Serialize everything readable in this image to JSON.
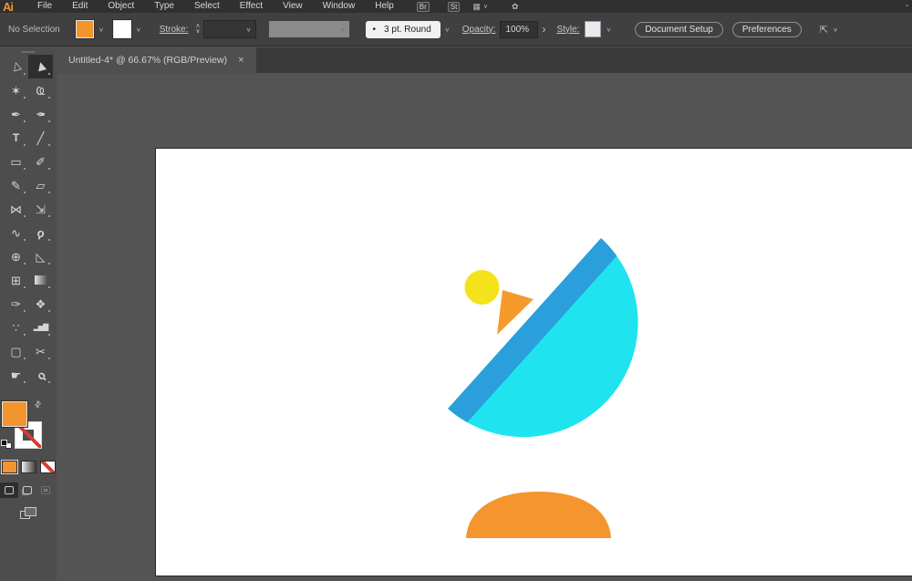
{
  "app": {
    "logo_text": "Ai"
  },
  "menu_bar": {
    "items": [
      "File",
      "Edit",
      "Object",
      "Type",
      "Select",
      "Effect",
      "View",
      "Window",
      "Help"
    ],
    "bridge_button": "Br",
    "stock_button": "St",
    "workspace_glyph": "▦",
    "workspace_chevron": "∨",
    "gpu_glyph": "✿",
    "corner_fragment": "⌄"
  },
  "control_bar": {
    "selection_status": "No Selection",
    "fill_chevron": "∨",
    "stroke_chevron": "∨",
    "stroke_label": "Stroke:",
    "stepper_up": "∧",
    "stepper_down": "∨",
    "stroke_width_chevron": "∨",
    "profile_chevron": "∨",
    "brush_bullet": "•",
    "brush_value": "3 pt. Round",
    "brush_chevron": "∨",
    "opacity_label": "Opacity:",
    "opacity_value": "100%",
    "opacity_more": "›",
    "style_label": "Style:",
    "style_chevron": "∨",
    "document_setup_button": "Document Setup",
    "preferences_button": "Preferences",
    "select_similar_glyph": "⇱",
    "select_similar_chevron": "∨"
  },
  "tab_bar": {
    "active_tab": {
      "title": "Untitled-4* @ 66.67% (RGB/Preview)",
      "close_glyph": "×"
    }
  },
  "toolbar": {
    "tools": [
      {
        "name": "selection-tool",
        "glyph": "▷",
        "active": false
      },
      {
        "name": "direct-selection-tool",
        "glyph": "▶",
        "active": true
      },
      {
        "name": "magic-wand-tool",
        "glyph": "✶",
        "active": false
      },
      {
        "name": "lasso-tool",
        "glyph": "Ҩ",
        "active": false
      },
      {
        "name": "pen-tool",
        "glyph": "✒",
        "active": false
      },
      {
        "name": "curvature-tool",
        "glyph": "✒",
        "active": false
      },
      {
        "name": "type-tool",
        "glyph": "T",
        "active": false
      },
      {
        "name": "line-segment-tool",
        "glyph": "╱",
        "active": false
      },
      {
        "name": "rectangle-tool",
        "glyph": "▭",
        "active": false
      },
      {
        "name": "paintbrush-tool",
        "glyph": "✐",
        "active": false
      },
      {
        "name": "pencil-tool",
        "glyph": "✎",
        "active": false
      },
      {
        "name": "eraser-tool",
        "glyph": "▱",
        "active": false
      },
      {
        "name": "reflect-tool",
        "glyph": "⋈",
        "active": false
      },
      {
        "name": "scale-tool",
        "glyph": "⇲",
        "active": false
      },
      {
        "name": "width-tool",
        "glyph": "∿",
        "active": false
      },
      {
        "name": "puppet-warp-tool",
        "glyph": "ϙ",
        "active": false
      },
      {
        "name": "shape-builder-tool",
        "glyph": "⊕",
        "active": false
      },
      {
        "name": "perspective-grid-tool",
        "glyph": "◺",
        "active": false
      },
      {
        "name": "mesh-tool",
        "glyph": "⊞",
        "active": false
      },
      {
        "name": "gradient-tool",
        "glyph": "",
        "active": false
      },
      {
        "name": "eyedropper-tool",
        "glyph": "✑",
        "active": false
      },
      {
        "name": "blend-tool",
        "glyph": "❖",
        "active": false
      },
      {
        "name": "symbol-sprayer-tool",
        "glyph": "∵",
        "active": false
      },
      {
        "name": "column-graph-tool",
        "glyph": "▂▅▇",
        "active": false
      },
      {
        "name": "artboard-tool",
        "glyph": "▢",
        "active": false
      },
      {
        "name": "slice-tool",
        "glyph": "✂",
        "active": false
      },
      {
        "name": "hand-tool",
        "glyph": "☛",
        "active": false
      },
      {
        "name": "zoom-tool",
        "glyph": "ϙ",
        "active": false
      }
    ],
    "swap_glyph": "⇄"
  },
  "colors": {
    "ui_fill_orange": "#F2952F",
    "dish_cyan": "#1FE4F0",
    "dish_stripe_blue": "#2B9FDB",
    "signal_yellow": "#F4E31C",
    "antenna_orange": "#F59A2B",
    "base_orange": "#F5952D"
  }
}
